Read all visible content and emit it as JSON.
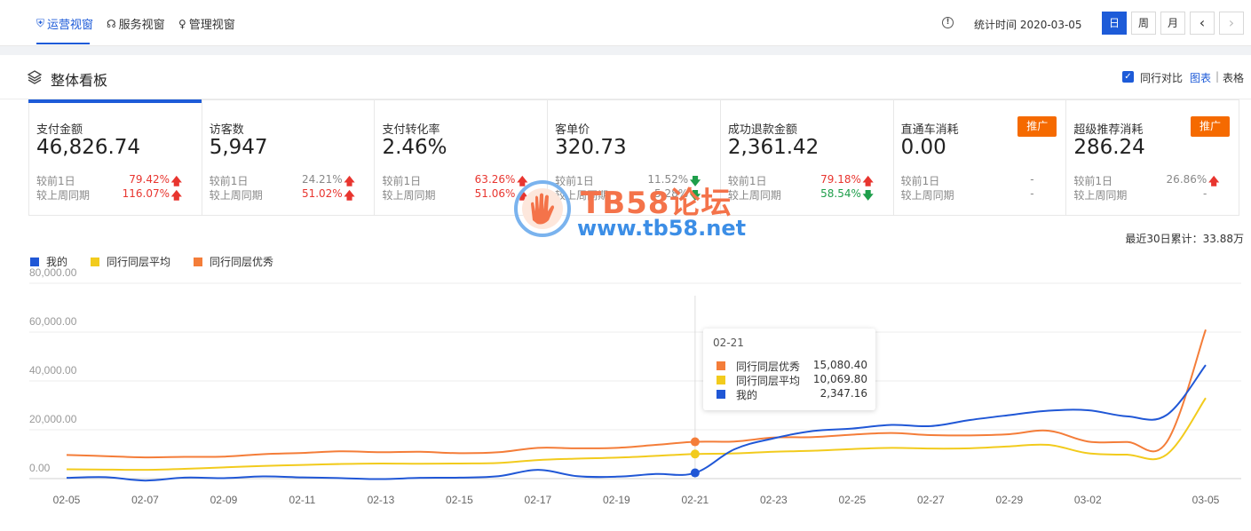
{
  "nav": {
    "tabs": [
      {
        "label": "运营视窗",
        "icon": "shield-icon",
        "active": true
      },
      {
        "label": "服务视窗",
        "icon": "headset-icon",
        "active": false
      },
      {
        "label": "管理视窗",
        "icon": "medal-icon",
        "active": false
      }
    ],
    "stat_time": "统计时间 2020-03-05",
    "periods": [
      "日",
      "周",
      "月"
    ],
    "active_period": "日",
    "prev_glyph": "‹",
    "next_glyph": "›"
  },
  "panel": {
    "title": "整体看板",
    "compare_label": "同行对比",
    "view_chart": "图表",
    "view_sep": "|",
    "view_table": "表格"
  },
  "cards": [
    {
      "title": "支付金额",
      "value": "46,826.74",
      "active": true,
      "row1": {
        "label": "较前1日",
        "value": "79.42%",
        "trend": "up"
      },
      "row2": {
        "label": "较上周同期",
        "value": "116.07%",
        "trend": "up"
      }
    },
    {
      "title": "访客数",
      "value": "5,947",
      "row1": {
        "label": "较前1日",
        "value": "24.21%",
        "trend": "up",
        "neutral_value": true
      },
      "row2": {
        "label": "较上周同期",
        "value": "51.02%",
        "trend": "up"
      }
    },
    {
      "title": "支付转化率",
      "value": "2.46%",
      "row1": {
        "label": "较前1日",
        "value": "63.26%",
        "trend": "up"
      },
      "row2": {
        "label": "较上周同期",
        "value": "51.06%",
        "trend": "up"
      }
    },
    {
      "title": "客单价",
      "value": "320.73",
      "row1": {
        "label": "较前1日",
        "value": "11.52%",
        "trend": "down",
        "neutral_value": true
      },
      "row2": {
        "label": "较上周同期",
        "value": "5.28%",
        "trend": "down",
        "neutral_value": true
      }
    },
    {
      "title": "成功退款金额",
      "value": "2,361.42",
      "row1": {
        "label": "较前1日",
        "value": "79.18%",
        "trend": "up"
      },
      "row2": {
        "label": "较上周同期",
        "value": "58.54%",
        "trend": "down"
      }
    },
    {
      "title": "直通车消耗",
      "value": "0.00",
      "promo": "推广",
      "row1": {
        "label": "较前1日",
        "value": "-",
        "trend": "none"
      },
      "row2": {
        "label": "较上周同期",
        "value": "-",
        "trend": "none"
      }
    },
    {
      "title": "超级推荐消耗",
      "value": "286.24",
      "promo": "推广",
      "row1": {
        "label": "较前1日",
        "value": "26.86%",
        "trend": "up",
        "neutral_value": true
      },
      "row2": {
        "label": "较上周同期",
        "value": "-",
        "trend": "none"
      }
    }
  ],
  "cumulative": "最近30日累计：33.88万",
  "watermark": {
    "title": "TB58论坛",
    "url": "www.tb58.net"
  },
  "colors": {
    "mine": "#2057d6",
    "avg": "#f2cb1d",
    "best": "#f47d39",
    "accent": "#1d5bd8",
    "up": "#e8352f",
    "down": "#1e9e4a",
    "promo": "#f56a00"
  },
  "tooltip": {
    "date": "02-21",
    "rows": [
      {
        "name": "同行同层优秀",
        "value": "15,080.40",
        "color": "#f47d39"
      },
      {
        "name": "同行同层平均",
        "value": "10,069.80",
        "color": "#f2cb1d"
      },
      {
        "name": "我的",
        "value": "2,347.16",
        "color": "#2057d6"
      }
    ]
  },
  "chart_data": {
    "type": "line",
    "title": "",
    "xlabel": "",
    "ylabel": "",
    "ylim": [
      0,
      80000
    ],
    "y_ticks": [
      "0.00",
      "20,000.00",
      "40,000.00",
      "60,000.00",
      "80,000.00"
    ],
    "y_tick_values": [
      0,
      20000,
      40000,
      60000,
      80000
    ],
    "x": [
      "02-05",
      "02-06",
      "02-07",
      "02-08",
      "02-09",
      "02-10",
      "02-11",
      "02-12",
      "02-13",
      "02-14",
      "02-15",
      "02-16",
      "02-17",
      "02-18",
      "02-19",
      "02-20",
      "02-21",
      "02-22",
      "02-23",
      "02-24",
      "02-25",
      "02-26",
      "02-27",
      "02-28",
      "02-29",
      "03-01",
      "03-02",
      "03-03",
      "03-04",
      "03-05"
    ],
    "x_tick_labels": [
      "02-05",
      "02-07",
      "02-09",
      "02-11",
      "02-13",
      "02-15",
      "02-17",
      "02-19",
      "02-21",
      "02-23",
      "02-25",
      "02-27",
      "02-29",
      "03-02",
      "03-05"
    ],
    "grid": true,
    "legend": "top-left",
    "highlight_index": 16,
    "series": [
      {
        "name": "我的",
        "key": "mine",
        "values": [
          300,
          600,
          -800,
          400,
          200,
          900,
          500,
          200,
          -200,
          300,
          400,
          1000,
          3600,
          1000,
          800,
          1900,
          2347,
          12000,
          16500,
          19500,
          20500,
          22000,
          21500,
          24000,
          26000,
          27800,
          28000,
          25500,
          26000,
          46500
        ]
      },
      {
        "name": "同行同层平均",
        "key": "avg",
        "values": [
          3800,
          3700,
          3600,
          4000,
          4600,
          5200,
          5600,
          6000,
          6200,
          6100,
          6200,
          6400,
          7600,
          8200,
          8600,
          9300,
          10070,
          10300,
          11000,
          11400,
          12100,
          12600,
          12300,
          12400,
          13200,
          13800,
          10400,
          9800,
          9800,
          33000
        ]
      },
      {
        "name": "同行同层优秀",
        "key": "best",
        "values": [
          9700,
          9200,
          8700,
          8900,
          9000,
          10000,
          10500,
          11200,
          10800,
          11000,
          10400,
          10800,
          12600,
          12400,
          12600,
          13800,
          15080,
          15200,
          16800,
          17000,
          18000,
          18700,
          17800,
          17700,
          18200,
          19600,
          15200,
          15000,
          14800,
          61000
        ]
      }
    ]
  }
}
